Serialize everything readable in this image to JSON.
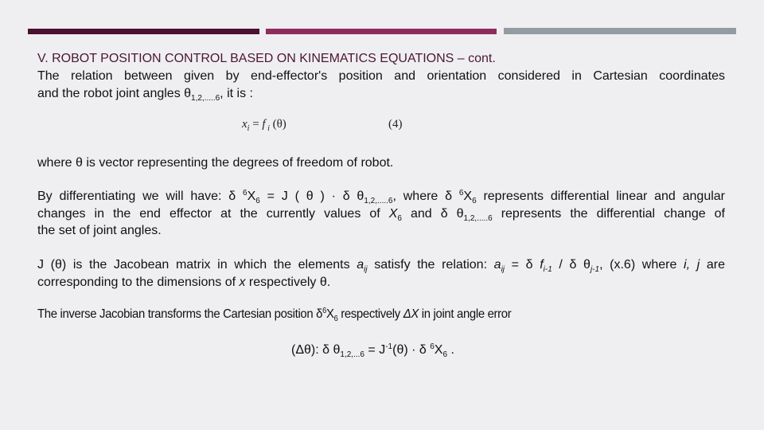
{
  "slide": {
    "accent_bars": [
      {
        "name": "bar-dark-maroon",
        "color": "#4a1130"
      },
      {
        "name": "bar-magenta",
        "color": "#8e2d5d"
      },
      {
        "name": "bar-gray",
        "color": "#959ba2"
      }
    ],
    "title": "V. ROBOT POSITION CONTROL BASED ON KINEMATICS EQUATIONS – cont.",
    "title_color": "#4d1634",
    "p1": {
      "line1": "The relation between given by end-effector's position and orientation considered in Cartesian coordinates",
      "line2_pre": "and the robot joint angles θ",
      "line2_sub": "1,2,.....6",
      "line2_post": ", it is :"
    },
    "eq4": {
      "x": "x",
      "x_sub": "i",
      "eq": " = ",
      "f": "f",
      "f_sub": " i",
      "arg": " (θ)",
      "number": "(4)"
    },
    "p2": "where θ is vector representing the degrees of freedom of robot.",
    "p3": {
      "a1": "By differentiating we will have: δ ",
      "a1_sup": "6",
      "a1_x": "X",
      "a1_xsub": "6",
      "a2": " = J ( θ ) · δ θ",
      "a2_sub": "1,2,.....6",
      "a3": ", where δ ",
      "a3_sup": "6",
      "a3_x": "X",
      "a3_xsub": "6",
      "a4": " represents differential linear and angular",
      "b1": "changes in the end effector at the currently values of ",
      "b1_x": "X",
      "b1_xsub": "6",
      "b2": " and δ θ",
      "b2_sub": "1,2,.....6",
      "b3": " represents the differential change of",
      "c1": "the set of joint angles."
    },
    "p4": {
      "a1": "J (θ) is the Jacobean matrix in which the elements ",
      "a1_a": "a",
      "a1_asub": "ij",
      "a2": " satisfy the relation: ",
      "a2_a": "a",
      "a2_asub": "ij",
      "a3": " = δ ",
      "a3_f": "f",
      "a3_fsub": "i-1",
      "a4": " / δ θ",
      "a4_sub": "j-1",
      "a5": ", (x.6) where ",
      "a5_ij": "i, j",
      "a6": " are",
      "b1": "corresponding to the dimensions of ",
      "b1_x": "x",
      "b2": " respectively θ."
    },
    "p5": {
      "a1": "The inverse Jacobian transforms the Cartesian position δ",
      "a1_sup": "6",
      "a1_x": "X",
      "a1_xsub": "6",
      "a2": " respectively ",
      "a2_dx": "ΔX",
      "a3": " in joint angle error"
    },
    "eq_final": {
      "a1": "(Δθ): δ θ",
      "a1_sub": "1,2,...6",
      "a2": " = J",
      "a2_sup": "-1",
      "a3": "(θ) · δ ",
      "a3_sup": "6",
      "a3_x": "X",
      "a3_xsub": "6",
      "a4": " ."
    }
  }
}
